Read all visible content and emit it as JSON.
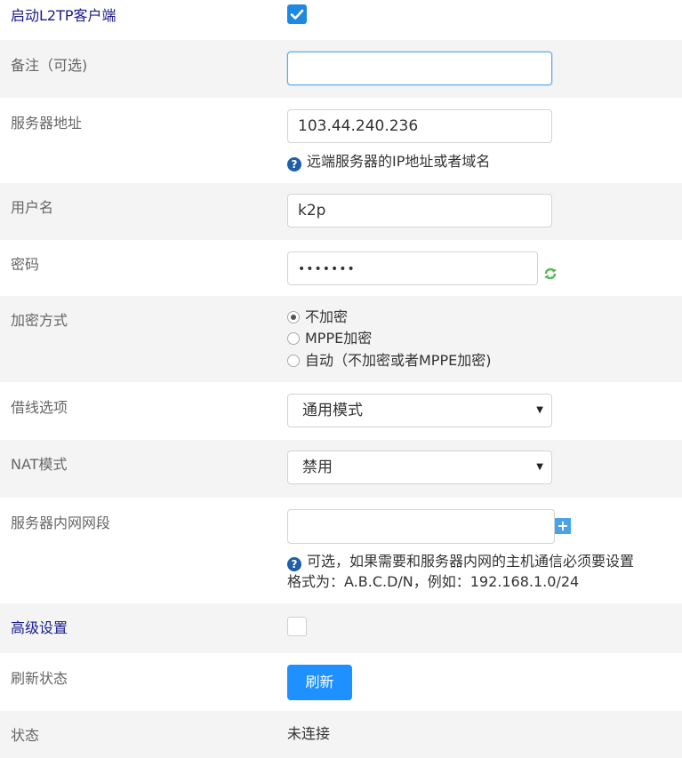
{
  "l2tp_enable": {
    "label": "启动L2TP客户端",
    "checked": true
  },
  "remark": {
    "label": "备注（可选)",
    "value": ""
  },
  "server": {
    "label": "服务器地址",
    "value": "103.44.240.236",
    "help": "远端服务器的IP地址或者域名"
  },
  "username": {
    "label": "用户名",
    "value": "k2p"
  },
  "password": {
    "label": "密码",
    "masked": "•••••••"
  },
  "encryption": {
    "label": "加密方式",
    "options": [
      "不加密",
      "MPPE加密",
      "自动（不加密或者MPPE加密)"
    ],
    "selected_index": 0
  },
  "line_option": {
    "label": "借线选项",
    "selected": "通用模式"
  },
  "nat_mode": {
    "label": "NAT模式",
    "selected": "禁用"
  },
  "subnet": {
    "label": "服务器内网网段",
    "value": "",
    "help_line1": "可选，如果需要和服务器内网的主机通信必须要设置",
    "help_line2": "格式为：A.B.C.D/N，例如：192.168.1.0/24"
  },
  "advanced": {
    "label": "高级设置",
    "checked": false
  },
  "refresh": {
    "label": "刷新状态",
    "button": "刷新"
  },
  "status": {
    "label": "状态",
    "value": "未连接"
  },
  "colors": {
    "primary": "#1e90ff",
    "label_blue": "#1a1a8c",
    "row_alt": "#f4f4f4",
    "help_icon": "#1f5fa8"
  }
}
